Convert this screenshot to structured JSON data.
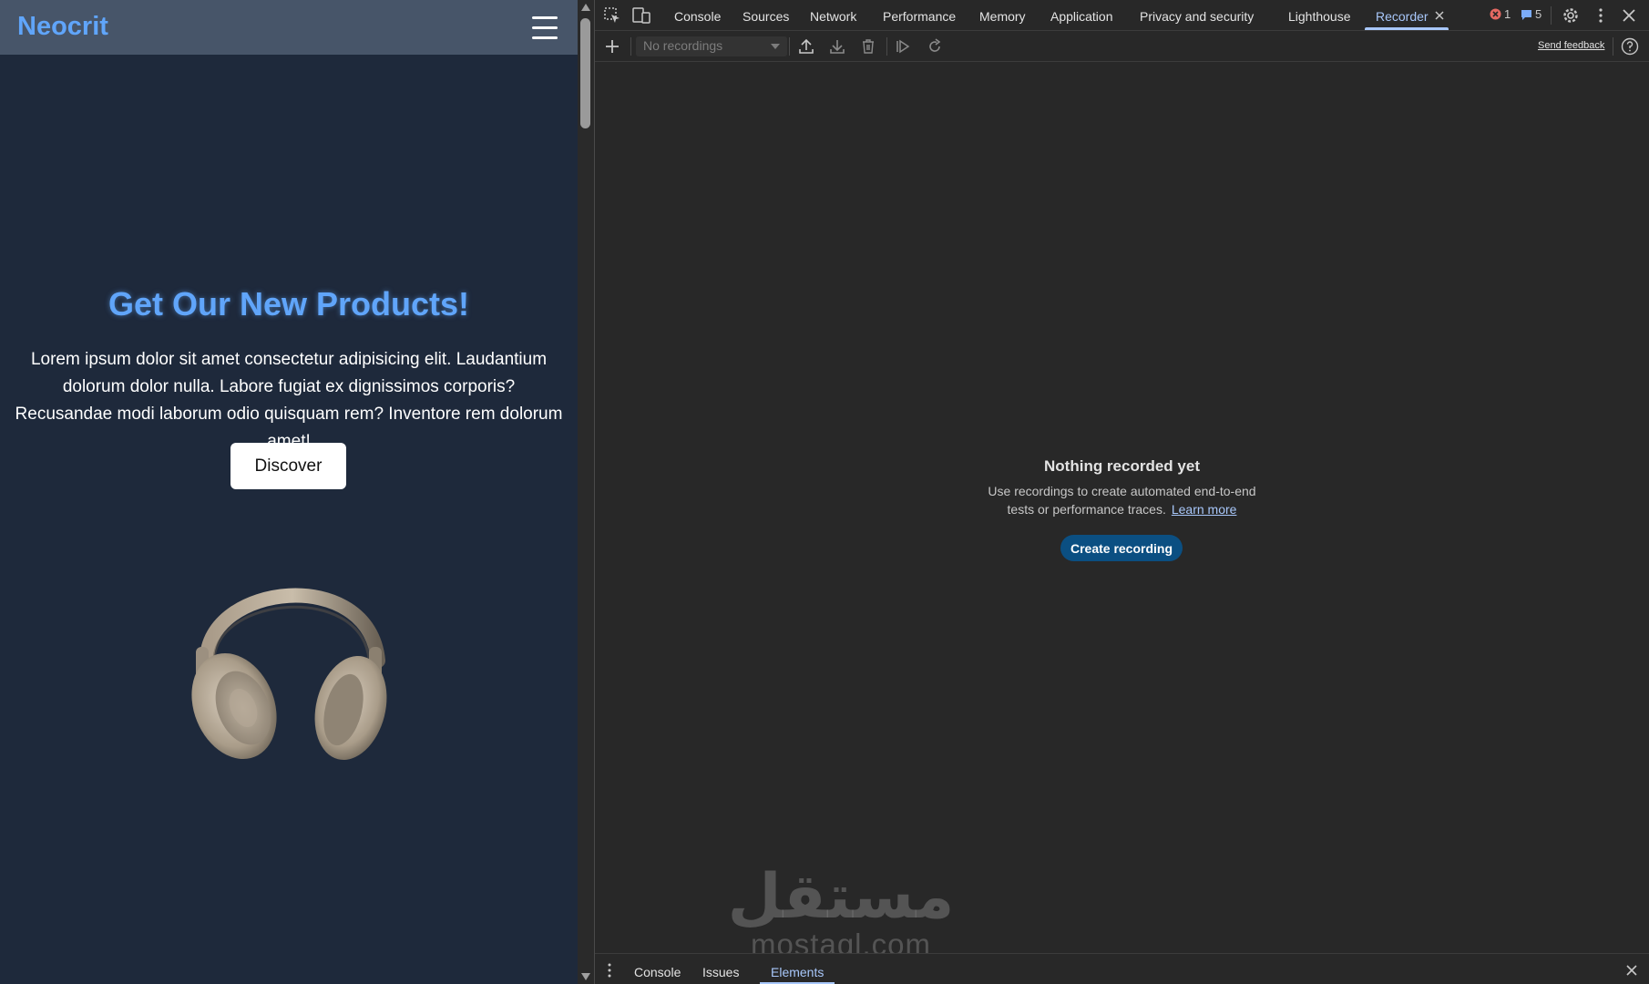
{
  "page": {
    "brand": "Neocrit",
    "hero_title": "Get Our New Products!",
    "hero_text": "Lorem ipsum dolor sit amet consectetur adipisicing elit. Laudantium dolorum dolor nulla. Labore fugiat ex dignissimos corporis? Recusandae modi laborum odio quisquam rem? Inventore rem dolorum amet!",
    "discover_label": "Discover"
  },
  "devtools": {
    "tabs": [
      {
        "label": "Console"
      },
      {
        "label": "Sources"
      },
      {
        "label": "Network"
      },
      {
        "label": "Performance"
      },
      {
        "label": "Memory"
      },
      {
        "label": "Application"
      },
      {
        "label": "Privacy and security"
      },
      {
        "label": "Lighthouse"
      },
      {
        "label": "Recorder"
      }
    ],
    "active_tab": "Recorder",
    "error_count": "1",
    "message_count": "5",
    "recordings_placeholder": "No recordings",
    "send_feedback": "Send feedback",
    "empty_title": "Nothing recorded yet",
    "empty_text_line1": "Use recordings to create automated end-to-end",
    "empty_text_line2": "tests or performance traces.",
    "learn_more": "Learn more",
    "create_recording": "Create recording",
    "drawer_tabs": [
      {
        "label": "Console"
      },
      {
        "label": "Issues"
      },
      {
        "label": "Elements"
      }
    ],
    "active_drawer_tab": "Elements"
  },
  "watermark": {
    "arabic": "مستقل",
    "latin": "mostaql.com"
  },
  "colors": {
    "page_bg": "#1e293b",
    "page_header": "#475569",
    "accent_blue": "#60a5fa",
    "devtools_bg": "#282828",
    "devtools_accent": "#a8c7fa",
    "create_button": "#0b4f82"
  },
  "icons": {
    "menu": "hamburger-icon",
    "inspect": "inspect-element-icon",
    "device": "device-toolbar-icon",
    "close_tab": "close-icon",
    "error": "error-icon",
    "message": "message-icon",
    "settings": "gear-icon",
    "more": "kebab-menu-icon",
    "close_devtools": "close-icon",
    "add": "plus-icon",
    "export": "upload-icon",
    "import": "download-icon",
    "delete": "trash-icon",
    "replay": "replay-icon",
    "step": "redo-icon",
    "help": "help-icon"
  }
}
